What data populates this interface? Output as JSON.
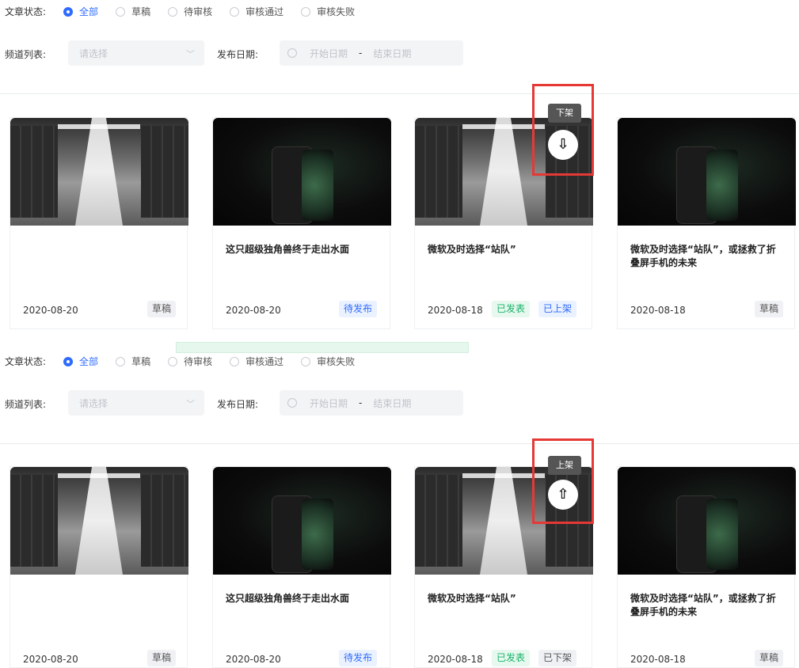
{
  "filters": {
    "status_label": "文章状态:",
    "status_options": [
      "全部",
      "草稿",
      "待审核",
      "审核通过",
      "审核失败"
    ],
    "channel_label": "频道列表:",
    "channel_placeholder": "请选择",
    "date_label": "发布日期:",
    "date_start_placeholder": "开始日期",
    "date_separator": "-",
    "date_end_placeholder": "结束日期"
  },
  "panels": [
    {
      "tooltip": "下架",
      "cards": [
        {
          "title": "",
          "date": "2020-08-20",
          "tags": [
            "草稿"
          ]
        },
        {
          "title": "这只超级独角兽终于走出水面",
          "date": "2020-08-20",
          "tags": [
            "待发布"
          ]
        },
        {
          "title": "微软及时选择“站队”",
          "date": "2020-08-18",
          "tags": [
            "已发表",
            "已上架"
          ]
        },
        {
          "title": "微软及时选择“站队”，或拯救了折叠屏手机的未来",
          "date": "2020-08-18",
          "tags": [
            "草稿"
          ]
        }
      ]
    },
    {
      "tooltip": "上架",
      "cards": [
        {
          "title": "",
          "date": "2020-08-20",
          "tags": [
            "草稿"
          ]
        },
        {
          "title": "这只超级独角兽终于走出水面",
          "date": "2020-08-20",
          "tags": [
            "待发布"
          ]
        },
        {
          "title": "微软及时选择“站队”",
          "date": "2020-08-18",
          "tags": [
            "已发表",
            "已下架"
          ]
        },
        {
          "title": "微软及时选择“站队”，或拯救了折叠屏手机的未来",
          "date": "2020-08-18",
          "tags": [
            "草稿"
          ]
        }
      ]
    }
  ],
  "colors": {
    "accent": "#2f6bff",
    "highlight": "#e53935",
    "published": "#19b36b"
  },
  "icons": {
    "takedown": "download-arrow-icon",
    "publish": "upload-arrow-icon"
  }
}
